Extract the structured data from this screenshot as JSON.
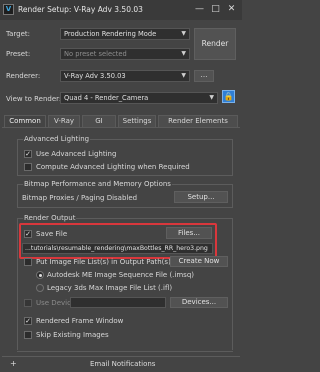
{
  "window": {
    "title": "Render Setup: V-Ray Adv 3.50.03",
    "app_icon": "app-icon",
    "buttons": {
      "minimize": "—",
      "maximize": "□",
      "close": "✕"
    }
  },
  "form": {
    "target_label": "Target:",
    "target_value": "Production Rendering Mode",
    "preset_label": "Preset:",
    "preset_value": "No preset selected",
    "renderer_label": "Renderer:",
    "renderer_value": "V-Ray Adv 3.50.03",
    "render_button": "Render",
    "view_label": "View to Render:",
    "view_value": "Quad 4 - Render_Camera",
    "lock_icon": "lock-icon"
  },
  "tabs": [
    "Common",
    "V-Ray",
    "GI",
    "Settings",
    "Render Elements"
  ],
  "active_tab": "Common",
  "advanced_lighting": {
    "title": "Advanced Lighting",
    "use_label": "Use Advanced Lighting",
    "use_checked": true,
    "compute_label": "Compute Advanced Lighting when Required",
    "compute_checked": false
  },
  "bitmap": {
    "title": "Bitmap Performance and Memory Options",
    "status": "Bitmap Proxies / Paging Disabled",
    "setup_button": "Setup..."
  },
  "render_output": {
    "title": "Render Output",
    "save_file_label": "Save File",
    "save_file_checked": true,
    "files_button": "Files...",
    "file_path": "...tutorials\\resumable_rendering\\maxBottles_RR_hero3.png",
    "put_image_label": "Put Image File List(s) in Output Path(s)",
    "put_image_checked": false,
    "create_now_button": "Create Now",
    "radio_autodesk": "Autodesk ME Image Sequence File (.imsq)",
    "radio_legacy": "Legacy 3ds Max Image File List (.ifl)",
    "use_device_label": "Use Device",
    "devices_button": "Devices...",
    "rendered_frame_label": "Rendered Frame Window",
    "rendered_frame_checked": true,
    "skip_existing_label": "Skip Existing Images",
    "skip_existing_checked": false
  },
  "email": {
    "toggle": "+",
    "title": "Email Notifications"
  }
}
